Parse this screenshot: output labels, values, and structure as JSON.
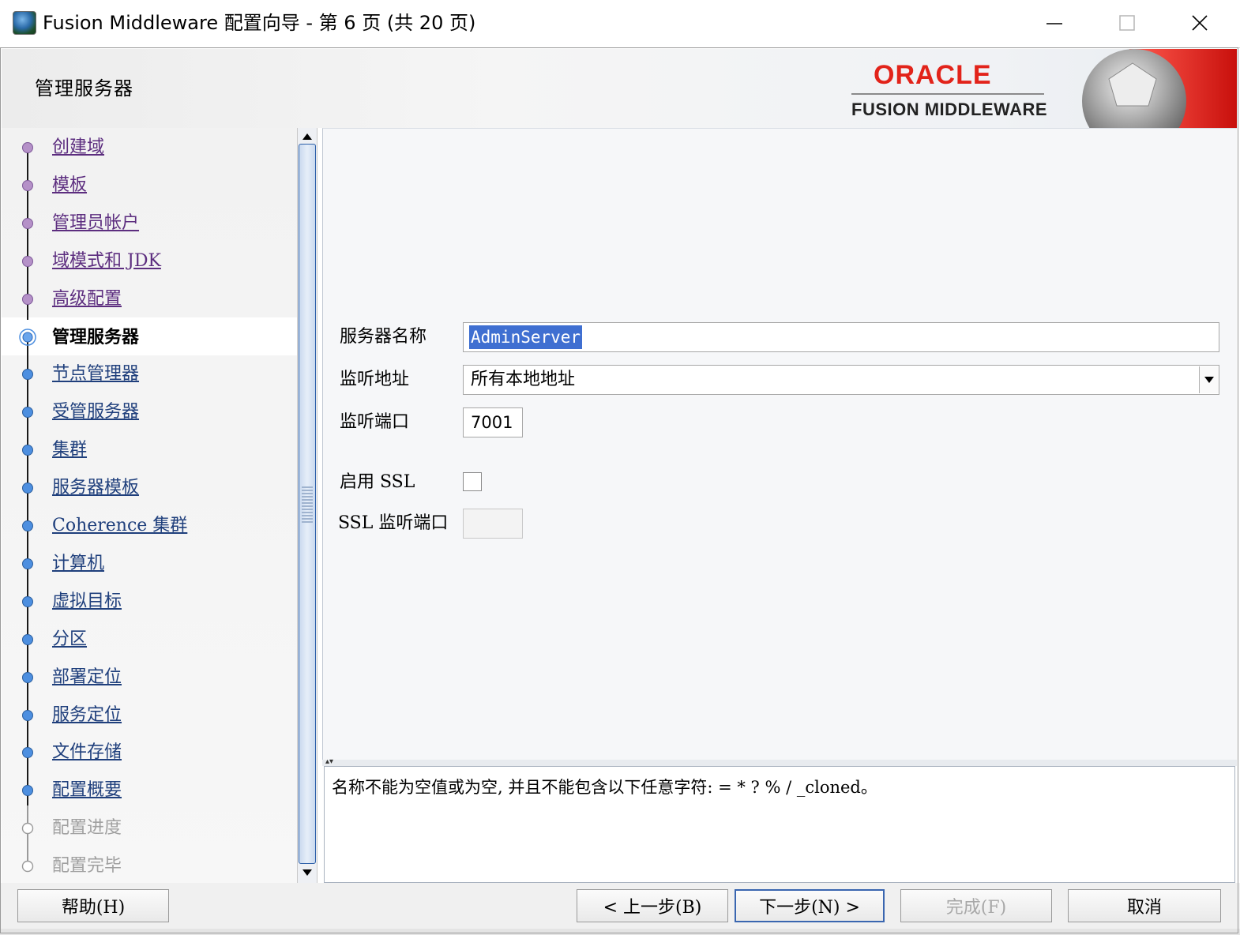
{
  "window": {
    "title": "Fusion Middleware 配置向导 - 第 6 页 (共 20 页)"
  },
  "header": {
    "page_heading": "管理服务器",
    "brand_oracle": "ORACLE",
    "brand_product": "FUSION MIDDLEWARE"
  },
  "nav": {
    "items": [
      {
        "label": "创建域",
        "state": "done"
      },
      {
        "label": "模板",
        "state": "done"
      },
      {
        "label": "管理员帐户",
        "state": "done"
      },
      {
        "label": "域模式和 JDK",
        "state": "done"
      },
      {
        "label": "高级配置",
        "state": "done"
      },
      {
        "label": "管理服务器",
        "state": "current"
      },
      {
        "label": "节点管理器",
        "state": "next"
      },
      {
        "label": "受管服务器",
        "state": "next"
      },
      {
        "label": "集群",
        "state": "next"
      },
      {
        "label": "服务器模板",
        "state": "next"
      },
      {
        "label": "Coherence 集群",
        "state": "next"
      },
      {
        "label": "计算机",
        "state": "next"
      },
      {
        "label": "虚拟目标",
        "state": "next"
      },
      {
        "label": "分区",
        "state": "next"
      },
      {
        "label": "部署定位",
        "state": "next"
      },
      {
        "label": "服务定位",
        "state": "next"
      },
      {
        "label": "文件存储",
        "state": "next"
      },
      {
        "label": "配置概要",
        "state": "next"
      },
      {
        "label": "配置进度",
        "state": "disabled"
      },
      {
        "label": "配置完毕",
        "state": "disabled"
      }
    ]
  },
  "form": {
    "server_name_label": "服务器名称",
    "server_name_value": "AdminServer",
    "listen_address_label": "监听地址",
    "listen_address_value": "所有本地地址",
    "listen_port_label": "监听端口",
    "listen_port_value": "7001",
    "enable_ssl_label": "启用 SSL",
    "enable_ssl_checked": false,
    "ssl_port_label": "SSL 监听端口",
    "ssl_port_value": ""
  },
  "message": {
    "text": "名称不能为空值或为空, 并且不能包含以下任意字符: = * ? % / _cloned。"
  },
  "buttons": {
    "help": "帮助(H)",
    "back": "< 上一步(B)",
    "next": "下一步(N) >",
    "finish": "完成(F)",
    "cancel": "取消"
  },
  "colors": {
    "oracle_red": "#e2231a",
    "visited_link": "#5c2d7f",
    "pending_link": "#1f3f7c",
    "selection": "#3f6fd1",
    "disabled_text": "#a0a0a0"
  }
}
